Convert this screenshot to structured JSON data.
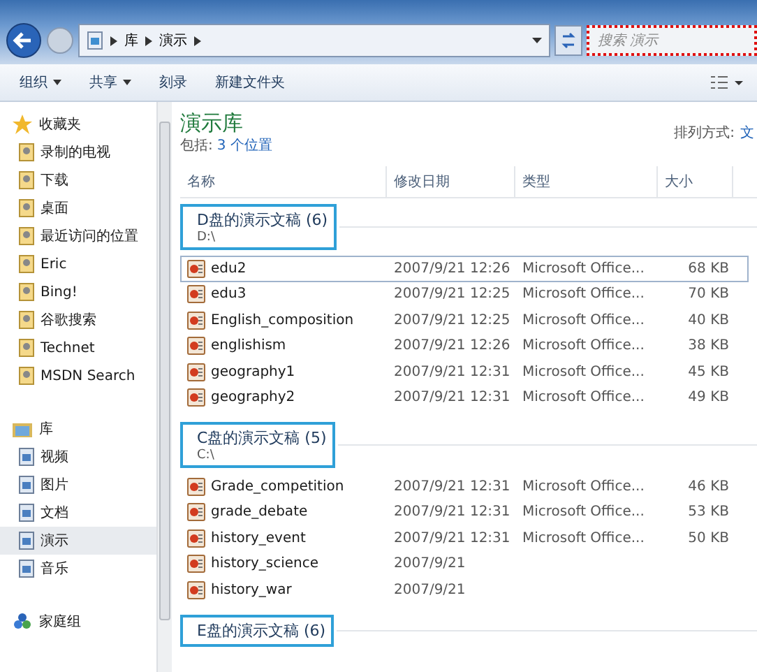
{
  "nav": {
    "breadcrumb": [
      "库",
      "演示"
    ],
    "search": {
      "placeholder": "搜索 演示",
      "highlighted": true
    }
  },
  "toolbar": {
    "buttons": [
      {
        "label": "组织",
        "dropdown": true
      },
      {
        "label": "共享",
        "dropdown": true
      },
      {
        "label": "刻录",
        "dropdown": false
      },
      {
        "label": "新建文件夹",
        "dropdown": false
      }
    ]
  },
  "sidebar": {
    "sections": [
      {
        "label": "收藏夹",
        "children": [
          {
            "label": "录制的电视",
            "selected": false
          },
          {
            "label": "下载",
            "selected": false
          },
          {
            "label": "桌面",
            "selected": false
          },
          {
            "label": "最近访问的位置",
            "selected": false
          },
          {
            "label": "Eric",
            "selected": false
          },
          {
            "label": "Bing!",
            "selected": false
          },
          {
            "label": "谷歌搜索",
            "selected": false
          },
          {
            "label": "Technet",
            "selected": false
          },
          {
            "label": "MSDN  Search",
            "selected": false
          }
        ]
      },
      {
        "label": "库",
        "children": [
          {
            "label": "视频",
            "selected": false
          },
          {
            "label": "图片",
            "selected": false
          },
          {
            "label": "文档",
            "selected": false
          },
          {
            "label": "演示",
            "selected": true
          },
          {
            "label": "音乐",
            "selected": false
          }
        ]
      },
      {
        "label": "家庭组"
      }
    ]
  },
  "library": {
    "title": "演示库",
    "includes_label": "包括:",
    "includes_link": "3 个位置",
    "arrange_label": "排列方式:",
    "arrange_value": "文"
  },
  "columns": [
    "名称",
    "修改日期",
    "类型",
    "大小"
  ],
  "groups": [
    {
      "title": "D盘的演示文稿 (6)",
      "path": "D:\\",
      "highlighted": true,
      "rows": [
        {
          "name": "edu2",
          "date": "2007/9/21 12:26",
          "type": "Microsoft Office...",
          "size": "68 KB",
          "selected": true
        },
        {
          "name": "edu3",
          "date": "2007/9/21 12:25",
          "type": "Microsoft Office...",
          "size": "70 KB",
          "selected": false
        },
        {
          "name": "English_composition",
          "date": "2007/9/21 12:25",
          "type": "Microsoft Office...",
          "size": "40 KB",
          "selected": false
        },
        {
          "name": "englishism",
          "date": "2007/9/21 12:26",
          "type": "Microsoft Office...",
          "size": "38 KB",
          "selected": false
        },
        {
          "name": "geography1",
          "date": "2007/9/21 12:31",
          "type": "Microsoft Office...",
          "size": "45 KB",
          "selected": false
        },
        {
          "name": "geography2",
          "date": "2007/9/21 12:31",
          "type": "Microsoft Office...",
          "size": "49 KB",
          "selected": false
        }
      ]
    },
    {
      "title": "C盘的演示文稿 (5)",
      "path": "C:\\",
      "highlighted": true,
      "rows": [
        {
          "name": "Grade_competition",
          "date": "2007/9/21 12:31",
          "type": "Microsoft Office...",
          "size": "46 KB",
          "selected": false
        },
        {
          "name": "grade_debate",
          "date": "2007/9/21 12:31",
          "type": "Microsoft Office...",
          "size": "53 KB",
          "selected": false
        },
        {
          "name": "history_event",
          "date": "2007/9/21 12:31",
          "type": "Microsoft Office...",
          "size": "50 KB",
          "selected": false
        },
        {
          "name": "history_science",
          "date": "2007/9/21",
          "selected": false
        },
        {
          "name": "history_war",
          "date": "2007/9/21",
          "selected": false
        }
      ]
    },
    {
      "title": "E盘的演示文稿 (6)",
      "highlighted": true
    }
  ]
}
